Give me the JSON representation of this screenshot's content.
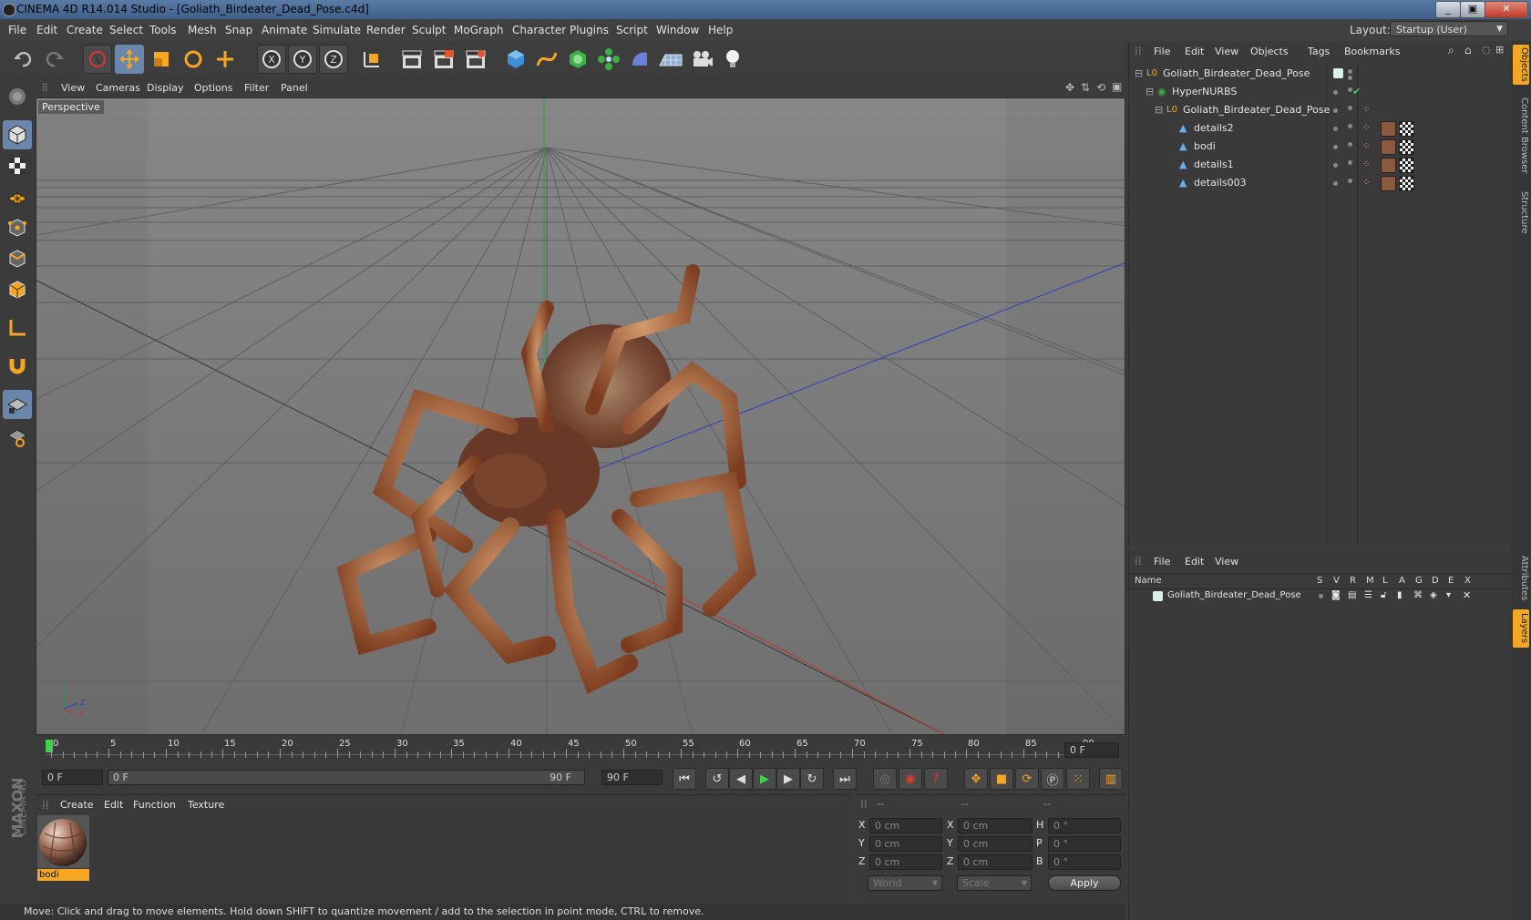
{
  "title_bar": {
    "text": "CINEMA 4D R14.014 Studio - [Goliath_Birdeater_Dead_Pose.c4d]",
    "window_buttons": [
      "_",
      "▣",
      "✕"
    ]
  },
  "menu": [
    "File",
    "Edit",
    "Create",
    "Select",
    "Tools",
    "Mesh",
    "Snap",
    "Animate",
    "Simulate",
    "Render",
    "Sculpt",
    "MoGraph",
    "Character",
    "Plugins",
    "Script",
    "Window",
    "Help"
  ],
  "layout": {
    "label": "Layout:",
    "value": "Startup (User)"
  },
  "viewport": {
    "menu": [
      "View",
      "Cameras",
      "Display",
      "Options",
      "Filter",
      "Panel"
    ],
    "label": "Perspective",
    "axes": {
      "y": "Y",
      "z": "Z",
      "x": "X"
    }
  },
  "timeline": {
    "ticks": [
      "0",
      "5",
      "10",
      "15",
      "20",
      "25",
      "30",
      "35",
      "40",
      "45",
      "50",
      "55",
      "60",
      "65",
      "70",
      "75",
      "80",
      "85",
      "90"
    ],
    "current_frame": "0 F",
    "start_field": "0 F",
    "range_start": "0 F",
    "range_end": "90 F",
    "end_field": "90 F"
  },
  "material_panel": {
    "menu": [
      "Create",
      "Edit",
      "Function",
      "Texture"
    ],
    "materials": [
      {
        "name": "bodi"
      }
    ],
    "brand": {
      "maxon": "MAXON",
      "cinema": "CINEMA 4D"
    }
  },
  "coordinates": {
    "headers": [
      "--",
      "--",
      "--"
    ],
    "rows": [
      {
        "a": "X",
        "av": "0 cm",
        "b": "X",
        "bv": "0 cm",
        "c": "H",
        "cv": "0 °"
      },
      {
        "a": "Y",
        "av": "0 cm",
        "b": "Y",
        "bv": "0 cm",
        "c": "P",
        "cv": "0 °"
      },
      {
        "a": "Z",
        "av": "0 cm",
        "b": "Z",
        "bv": "0 cm",
        "c": "B",
        "cv": "0 °"
      }
    ],
    "world": "World",
    "scale": "Scale",
    "apply": "Apply"
  },
  "status": "Move: Click and drag to move elements. Hold down SHIFT to quantize movement / add to the selection in point mode, CTRL to remove.",
  "object_manager": {
    "menu": [
      "File",
      "Edit",
      "View",
      "Objects",
      "Tags",
      "Bookmarks"
    ],
    "objects": [
      {
        "name": "Goliath_Birdeater_Dead_Pose",
        "level": 0,
        "type": "null"
      },
      {
        "name": "HyperNURBS",
        "level": 1,
        "type": "nurbs"
      },
      {
        "name": "Goliath_Birdeater_Dead_Pose",
        "level": 2,
        "type": "null"
      },
      {
        "name": "details2",
        "level": 3,
        "type": "poly"
      },
      {
        "name": "bodi",
        "level": 3,
        "type": "poly"
      },
      {
        "name": "details1",
        "level": 3,
        "type": "poly"
      },
      {
        "name": "details003",
        "level": 3,
        "type": "poly"
      }
    ]
  },
  "layer_manager": {
    "menu": [
      "File",
      "Edit",
      "View"
    ],
    "columns": [
      "Name",
      "S",
      "V",
      "R",
      "M",
      "L",
      "A",
      "G",
      "D",
      "E",
      "X"
    ],
    "layers": [
      {
        "name": "Goliath_Birdeater_Dead_Pose"
      }
    ]
  },
  "side_tabs": [
    "Objects",
    "Content Browser",
    "Structure",
    "Attributes",
    "Layers"
  ],
  "colors": {
    "accent": "#f0a030",
    "selection": "#6a86aa",
    "layer_swatch": "#d8f0e8"
  }
}
